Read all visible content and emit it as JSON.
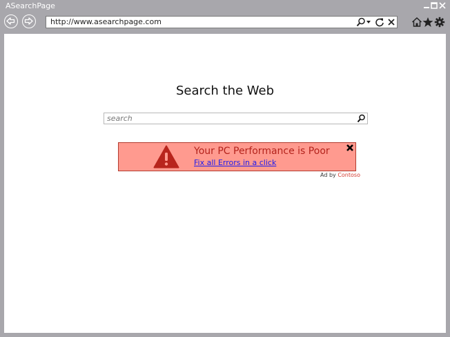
{
  "window": {
    "title": "ASearchPage"
  },
  "navigation": {
    "back_icon": "back-arrow-icon",
    "forward_icon": "forward-arrow-icon",
    "address": "http://www.asearchpage.com",
    "address_icons": [
      "search-icon",
      "chevron-down-icon",
      "refresh-icon",
      "close-icon"
    ]
  },
  "toolbar_icons": [
    "home-icon",
    "star-icon",
    "gear-icon"
  ],
  "page": {
    "heading": "Search the Web",
    "search_placeholder": "search"
  },
  "ad": {
    "title": "Your PC Performance is Poor",
    "link": "Fix all Errors in a click",
    "by_prefix": "Ad by ",
    "by_brand": "Contoso"
  },
  "colors": {
    "chrome": "#a8a7ac",
    "ad_background": "#ff9a8f",
    "ad_title": "#b3231c",
    "warning": "#b8251d",
    "link": "#1a1aee",
    "brand": "#d23a2f"
  }
}
